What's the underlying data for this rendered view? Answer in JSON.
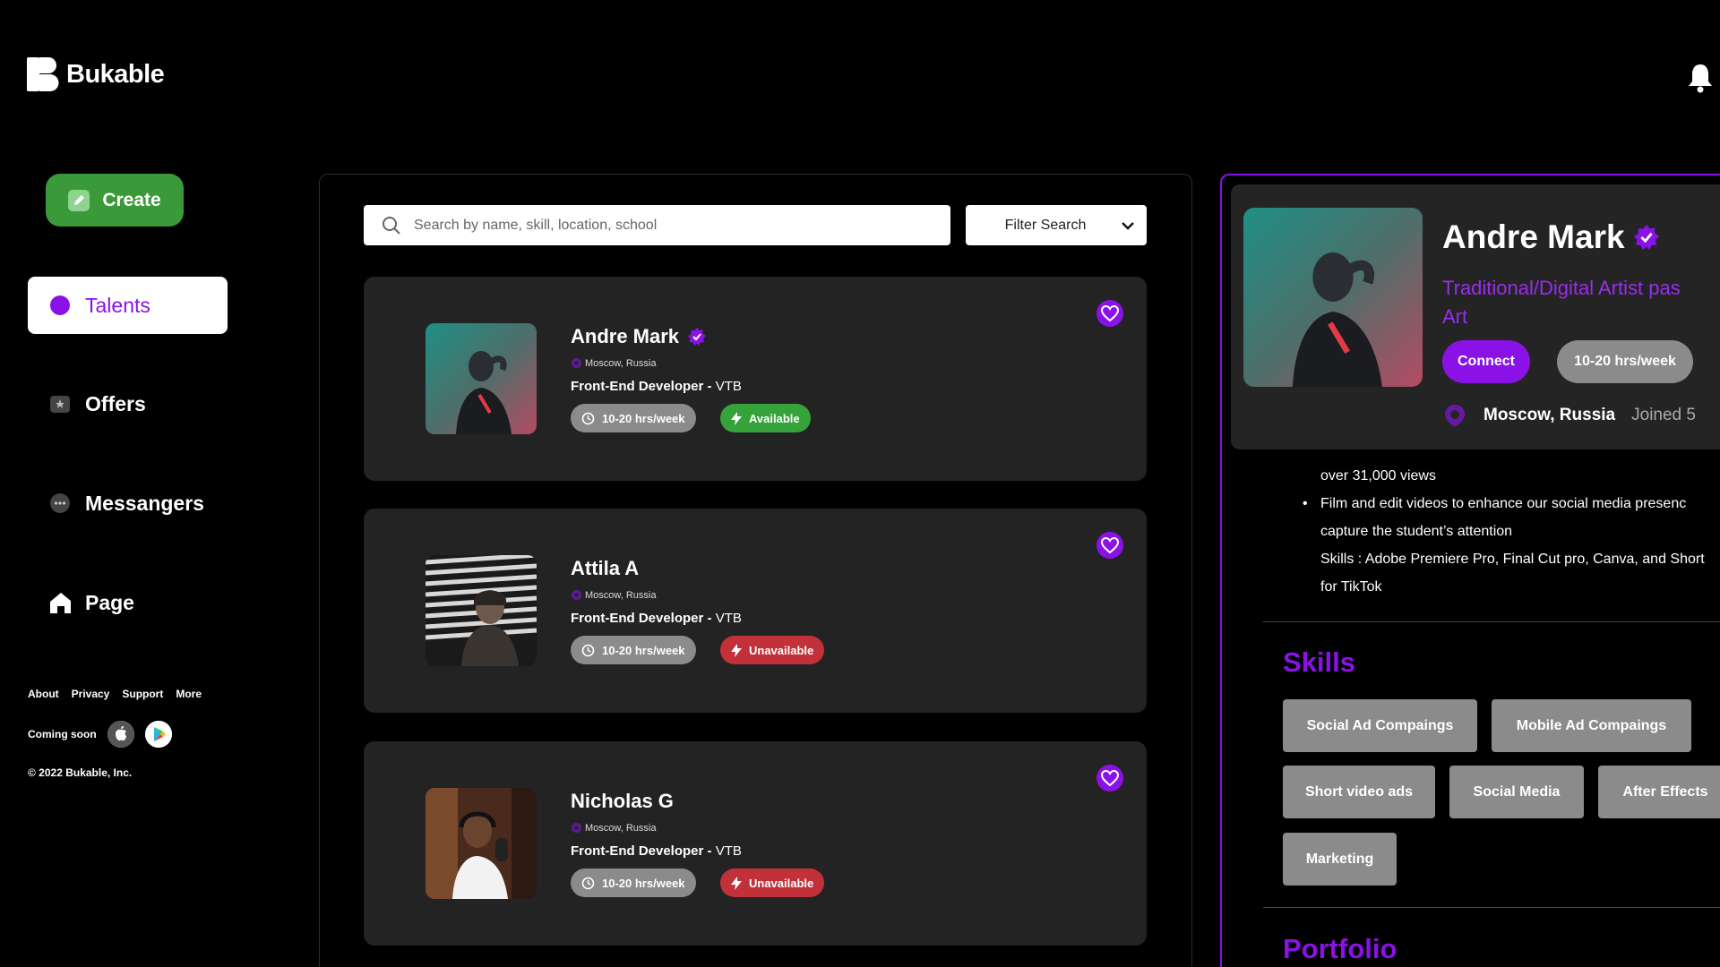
{
  "app": {
    "logo_text": "Bukable"
  },
  "sidebar": {
    "create_label": "Create",
    "items": [
      {
        "label": "Talents"
      },
      {
        "label": "Offers"
      },
      {
        "label": "Messangers"
      },
      {
        "label": "Page"
      }
    ],
    "footer_links": [
      "About",
      "Privacy",
      "Support",
      "More"
    ],
    "coming_soon": "Coming soon",
    "copyright": "© 2022 Bukable, Inc."
  },
  "search": {
    "placeholder": "Search by name, skill, location, school",
    "filter_label": "Filter Search"
  },
  "talents": [
    {
      "name": "Andre Mark",
      "verified": true,
      "location": "Moscow, Russia",
      "role": "Front-End Developer - ",
      "company": "VTB",
      "hours": "10-20 hrs/week",
      "status": "Available"
    },
    {
      "name": "Attila A",
      "verified": false,
      "location": "Moscow, Russia",
      "role": "Front-End Developer - ",
      "company": "VTB",
      "hours": "10-20 hrs/week",
      "status": "Unavailable"
    },
    {
      "name": "Nicholas G",
      "verified": false,
      "location": "Moscow, Russia",
      "role": "Front-End Developer - ",
      "company": "VTB",
      "hours": "10-20 hrs/week",
      "status": "Unavailable"
    }
  ],
  "profile": {
    "name": "Andre Mark",
    "title_line1": "Traditional/Digital Artist pas",
    "title_line2": "Art",
    "connect_label": "Connect",
    "hours": "10-20 hrs/week",
    "location": "Moscow, Russia",
    "joined": "Joined 5",
    "experience": [
      "over 31,000 views",
      "Film and edit videos to enhance our social media presenc",
      "capture the student’s attention",
      "Skills : Adobe Premiere Pro, Final Cut pro, Canva, and Short",
      "for TikTok"
    ],
    "skills_title": "Skills",
    "skills": [
      "Social Ad Compaings",
      "Mobile Ad Compaings",
      "Short video ads",
      "Social Media",
      "After Effects",
      "Marketing"
    ],
    "portfolio_title": "Portfolio"
  },
  "colors": {
    "accent": "#8a12e6",
    "green": "#3a9a3a",
    "red": "#c2313a",
    "card_bg": "#232323"
  }
}
